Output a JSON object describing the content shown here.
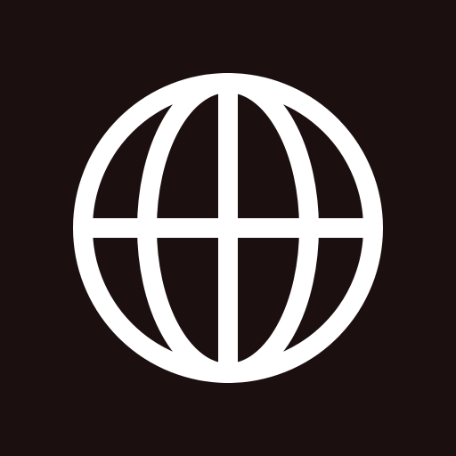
{
  "icon": {
    "name": "globe-icon",
    "background_color": "#1c0f10",
    "stroke_color": "#ffffff"
  }
}
